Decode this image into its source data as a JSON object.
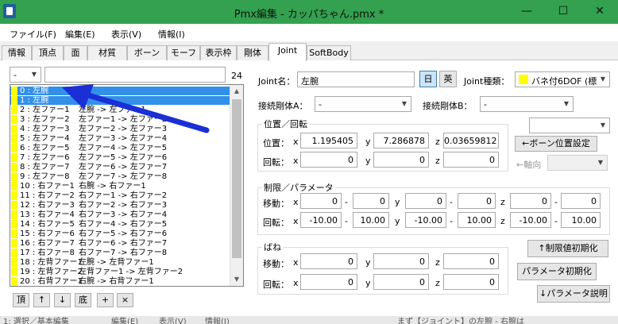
{
  "window": {
    "title": "Pmx編集 - カッパちゃん.pmx *",
    "minimize": "—",
    "maximize": "☐",
    "close": "✕"
  },
  "menu": [
    "ファイル(F)",
    "編集(E)",
    "表示(V)",
    "情報(I)"
  ],
  "tabs": [
    "情報",
    "頂点",
    "面",
    "材質",
    "ボーン",
    "モーフ",
    "表示枠",
    "剛体",
    "Joint",
    "SoftBody"
  ],
  "active_tab": "Joint",
  "filter": {
    "combo_value": "-",
    "text_value": "",
    "count": "24"
  },
  "joint_list": [
    {
      "c0": "0 : 左腕",
      "c1": "->"
    },
    {
      "c0": "1 : 左腕",
      "c1": ""
    },
    {
      "c0": "2 : 左ファー1",
      "c1": "左腕 -> 左ファー1"
    },
    {
      "c0": "3 : 左ファー2",
      "c1": "左ファー1 -> 左ファー2"
    },
    {
      "c0": "4 : 左ファー3",
      "c1": "左ファー2 -> 左ファー3"
    },
    {
      "c0": "5 : 左ファー4",
      "c1": "左ファー3 -> 左ファー4"
    },
    {
      "c0": "6 : 左ファー5",
      "c1": "左ファー4 -> 左ファー5"
    },
    {
      "c0": "7 : 左ファー6",
      "c1": "左ファー5 -> 左ファー6"
    },
    {
      "c0": "8 : 左ファー7",
      "c1": "左ファー6 -> 左ファー7"
    },
    {
      "c0": "9 : 左ファー8",
      "c1": "左ファー7 -> 左ファー8"
    },
    {
      "c0": "10 : 右ファー1",
      "c1": "右腕 -> 右ファー1"
    },
    {
      "c0": "11 : 右ファー2",
      "c1": "右ファー1 -> 右ファー2"
    },
    {
      "c0": "12 : 右ファー3",
      "c1": "右ファー2 -> 右ファー3"
    },
    {
      "c0": "13 : 右ファー4",
      "c1": "右ファー3 -> 右ファー4"
    },
    {
      "c0": "14 : 右ファー5",
      "c1": "右ファー4 -> 右ファー5"
    },
    {
      "c0": "15 : 右ファー6",
      "c1": "右ファー5 -> 右ファー6"
    },
    {
      "c0": "16 : 右ファー7",
      "c1": "右ファー6 -> 右ファー7"
    },
    {
      "c0": "17 : 右ファー8",
      "c1": "右ファー7 -> 右ファー8"
    },
    {
      "c0": "18 : 左背ファー1",
      "c1": "左腕 -> 左背ファー1"
    },
    {
      "c0": "19 : 左背ファー2",
      "c1": "左背ファー1 -> 左背ファー2"
    },
    {
      "c0": "20 : 右背ファー1",
      "c1": "右腕 -> 右背ファー1"
    }
  ],
  "list_buttons": [
    "頂",
    "↑",
    "↓",
    "底",
    "+",
    "×"
  ],
  "joint": {
    "name_label": "Joint名：",
    "name_value": "左腕",
    "lang_ja": "日",
    "lang_en": "英",
    "type_label": "Joint種類：",
    "type_value": "バネ付6DOF (標",
    "bodyA_label": "接続剛体A：",
    "bodyA_value": "-",
    "bodyB_label": "接続剛体B：",
    "bodyB_value": "-"
  },
  "pos_group": {
    "title": "位置／回転",
    "pos_label": "位置：",
    "rot_label": "回転：",
    "x": "x",
    "y": "y",
    "z": "z",
    "pos": [
      "1.195405",
      "7.286878",
      "0.03659812"
    ],
    "rot": [
      "0",
      "0",
      "0"
    ]
  },
  "right_tools": {
    "bone_combo": "",
    "bone_pos_button": "←ボーン位置設定",
    "axis_label": "←軸向",
    "axis_combo": ""
  },
  "limit_group": {
    "title": "制限／パラメータ",
    "move_label": "移動：",
    "rot_label": "回転：",
    "dash": "-",
    "x": "x",
    "y": "y",
    "z": "z",
    "move": [
      "0",
      "0",
      "0",
      "0",
      "0",
      "0"
    ],
    "rot": [
      "-10.00",
      "10.00",
      "-10.00",
      "10.00",
      "-10.00",
      "10.00"
    ]
  },
  "spring_group": {
    "title": "ばね",
    "move_label": "移動：",
    "rot_label": "回転：",
    "x": "x",
    "y": "y",
    "z": "z",
    "move": [
      "0",
      "0",
      "0"
    ],
    "rot": [
      "0",
      "0",
      "0"
    ]
  },
  "buttons": {
    "reset_limit": "↑制限値初期化",
    "reset_param": "パラメータ初期化",
    "param_help": "↓パラメータ説明"
  },
  "status": {
    "left": "1: 選択／基本編集",
    "mid1": "編集(E)",
    "mid2": "表示(V)",
    "mid3": "情報(I)",
    "right": "まず【ジョイント】の左腕 - 右腕は"
  },
  "colors": {
    "titlebar": "#33a14f",
    "selection": "#3390e8",
    "arrow": "#1a2fd6",
    "marker": "#ffff00"
  }
}
